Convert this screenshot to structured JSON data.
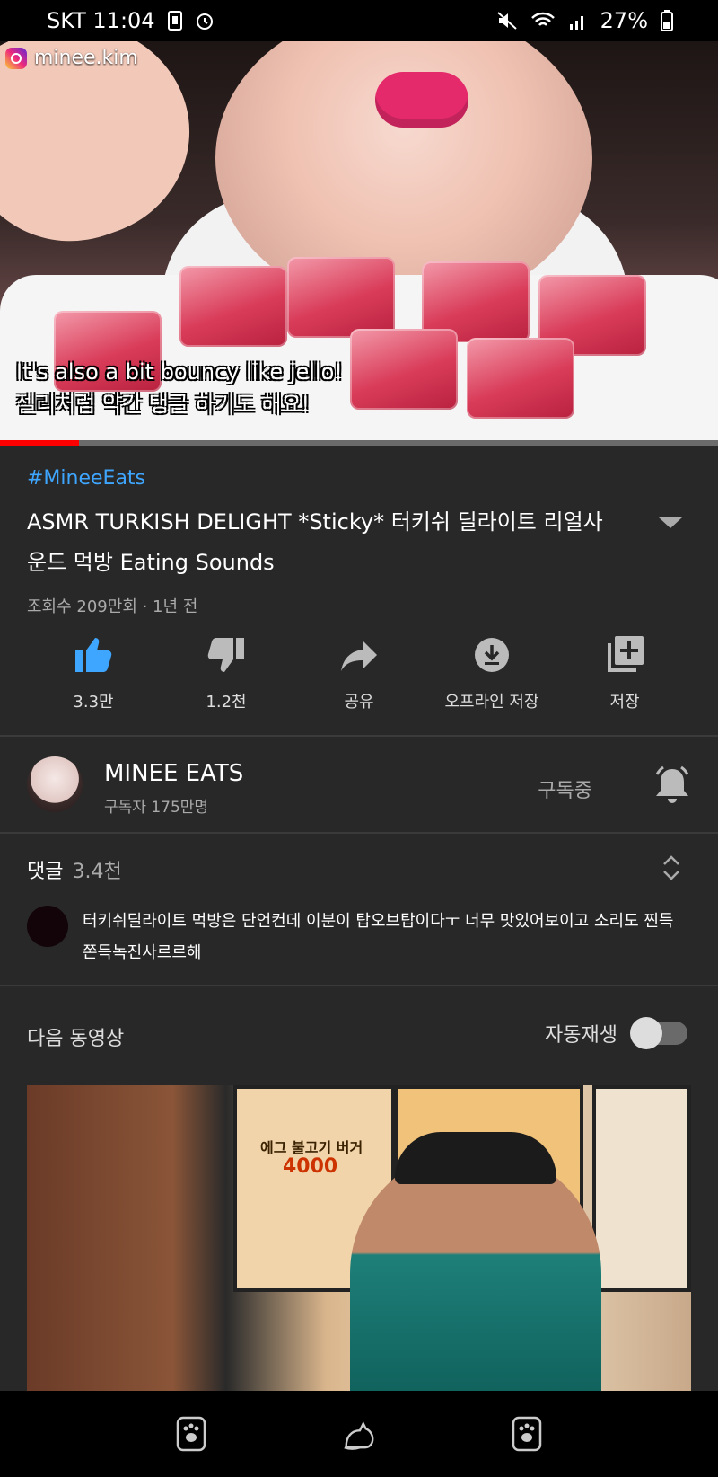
{
  "status_bar": {
    "carrier_time": "SKT 11:04",
    "battery_percent": "27%",
    "icons": [
      "sim-icon",
      "alarm-icon",
      "mute-icon",
      "wifi-icon",
      "signal-icon",
      "battery-icon"
    ]
  },
  "video": {
    "watermark": "minee.kim",
    "subtitle_en": "It's also a bit bouncy like jello!",
    "subtitle_ko": "젤리처럼 약간 탱글 하기도 해요!",
    "progress_fraction": 0.11
  },
  "info": {
    "hashtag": "#MineeEats",
    "title": "ASMR TURKISH DELIGHT *Sticky* 터키쉬 딜라이트 리얼사운드 먹방 Eating Sounds",
    "meta": "조회수 209만회 · 1년 전"
  },
  "actions": [
    {
      "label": "3.3만",
      "icon": "thumbs-up-icon"
    },
    {
      "label": "1.2천",
      "icon": "thumbs-down-icon"
    },
    {
      "label": "공유",
      "icon": "share-icon"
    },
    {
      "label": "오프라인 저장",
      "icon": "download-icon"
    },
    {
      "label": "저장",
      "icon": "add-to-playlist-icon"
    }
  ],
  "channel": {
    "name": "MINEE EATS",
    "subscribers": "구독자 175만명",
    "subscribed_label": "구독중"
  },
  "comments": {
    "title": "댓글",
    "count": "3.4천",
    "top_comment": "터키쉬딜라이트 먹방은 단언컨데 이분이 탑오브탑이다ㅜ 너무 맛있어보이고 소리도 찐득쫀득녹진사르르해"
  },
  "up_next": {
    "title": "다음 동영상",
    "autoplay_label": "자동재생",
    "autoplay_on": false,
    "thumb_promo": "에그 불고기 버거",
    "thumb_price": "4000"
  },
  "colors": {
    "background": "#282828",
    "accent_blue": "#3ea6ff",
    "progress_red": "#ff0000"
  }
}
